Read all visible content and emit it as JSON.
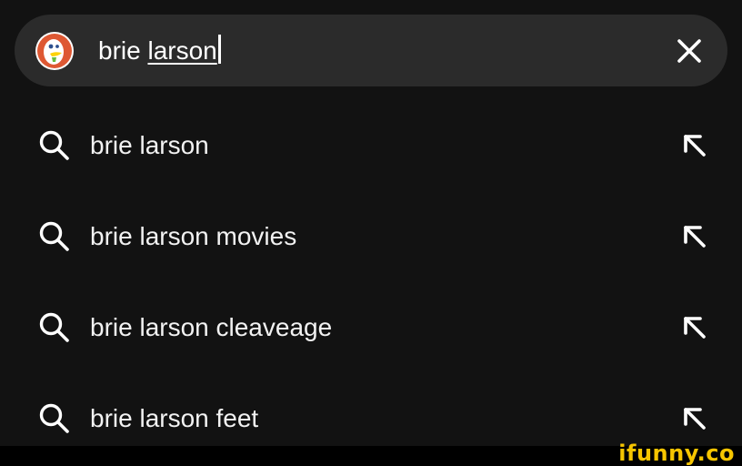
{
  "search_bar": {
    "query_plain": "brie ",
    "query_underlined": "larson",
    "clear_icon": "close-icon",
    "logo_icon": "duckduckgo-logo"
  },
  "suggestions": [
    {
      "label": "brie larson",
      "icon": "search-icon",
      "action_icon": "arrow-up-left-icon"
    },
    {
      "label": "brie larson movies",
      "icon": "search-icon",
      "action_icon": "arrow-up-left-icon"
    },
    {
      "label": "brie larson cleaveage",
      "icon": "search-icon",
      "action_icon": "arrow-up-left-icon"
    },
    {
      "label": "brie larson feet",
      "icon": "search-icon",
      "action_icon": "arrow-up-left-icon"
    }
  ],
  "watermark": "ifunny.co",
  "colors": {
    "background": "#121212",
    "search_bar": "#2b2b2b",
    "text": "#ffffff",
    "logo_orange": "#de5833",
    "watermark": "#f6c500"
  }
}
